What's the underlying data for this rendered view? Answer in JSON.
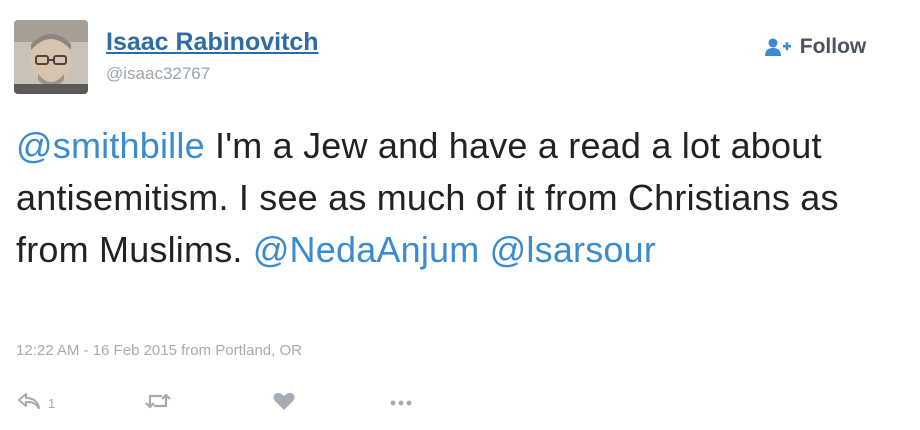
{
  "author": {
    "name": "Isaac Rabinovitch",
    "handle": "@isaac32767"
  },
  "follow_button": {
    "label": "Follow"
  },
  "tweet": {
    "segments": [
      {
        "type": "mention",
        "text": "@smithbille"
      },
      {
        "type": "text",
        "text": " I'm a Jew and have a read a lot about antisemitism. I see as much of it from Christians as from Muslims. "
      },
      {
        "type": "mention",
        "text": "@NedaAnjum"
      },
      {
        "type": "text",
        "text": " "
      },
      {
        "type": "mention",
        "text": "@lsarsour"
      }
    ],
    "meta": "12:22 AM - 16 Feb 2015 from Portland, OR"
  },
  "actions": {
    "reply_icon": "reply-icon",
    "reply_count": "1",
    "retweet_icon": "retweet-icon",
    "like_icon": "heart-icon",
    "more_icon": "more-icon"
  },
  "colors": {
    "name": "#2e6ca3",
    "mention": "#3a8bd0",
    "muted": "#a3acb3"
  }
}
